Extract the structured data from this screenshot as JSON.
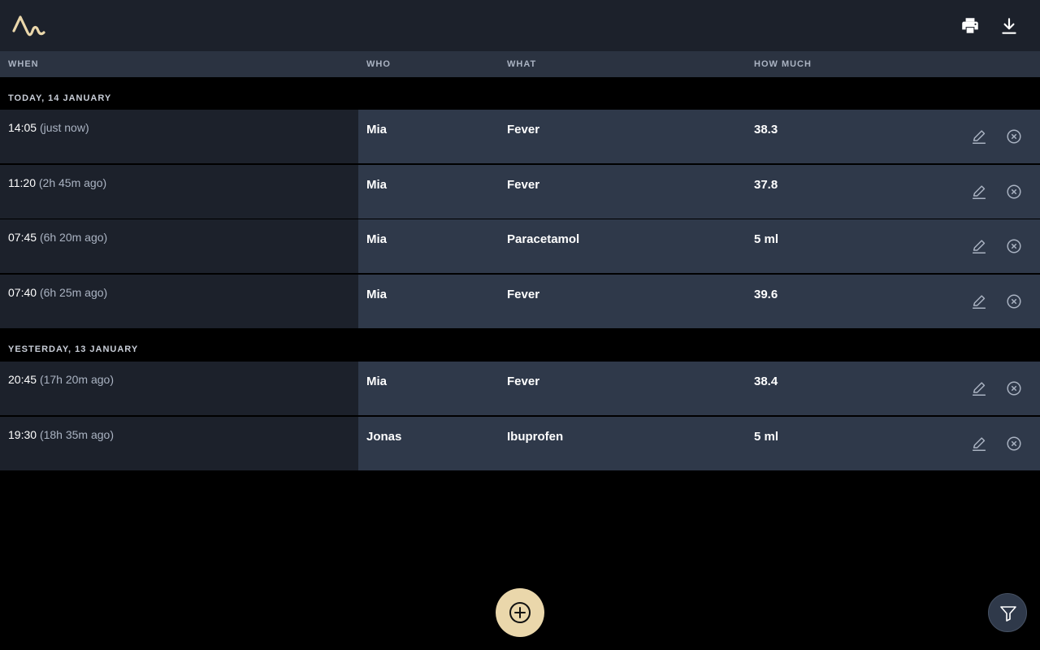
{
  "colors": {
    "topbar": "#1c212b",
    "header": "#2b3341",
    "when_cell": "#1c212b",
    "row_cell": "#2f394a",
    "accent": "#ead7ab"
  },
  "toolbar": {
    "logo_icon": "pulse-logo-icon",
    "print_icon": "printer-icon",
    "download_icon": "download-icon"
  },
  "columns": [
    "WHEN",
    "WHO",
    "WHAT",
    "HOW MUCH"
  ],
  "groups": [
    {
      "label": "TODAY, 14 JANUARY",
      "rows": [
        {
          "time": "14:05",
          "ago": "(just now)",
          "who": "Mia",
          "what": "Fever",
          "amount": "38.3"
        },
        {
          "time": "11:20",
          "ago": "(2h 45m ago)",
          "who": "Mia",
          "what": "Fever",
          "amount": "37.8"
        },
        {
          "time": "07:45",
          "ago": "(6h 20m ago)",
          "who": "Mia",
          "what": "Paracetamol",
          "amount": "5 ml"
        },
        {
          "time": "07:40",
          "ago": "(6h 25m ago)",
          "who": "Mia",
          "what": "Fever",
          "amount": "39.6"
        }
      ]
    },
    {
      "label": "YESTERDAY, 13 JANUARY",
      "rows": [
        {
          "time": "20:45",
          "ago": "(17h 20m ago)",
          "who": "Mia",
          "what": "Fever",
          "amount": "38.4"
        },
        {
          "time": "19:30",
          "ago": "(18h 35m ago)",
          "who": "Jonas",
          "what": "Ibuprofen",
          "amount": "5 ml"
        }
      ]
    }
  ],
  "row_actions": {
    "edit_icon": "pencil-icon",
    "delete_icon": "close-circle-icon"
  },
  "fab": {
    "add_icon": "plus-circle-icon",
    "filter_icon": "filter-icon"
  }
}
